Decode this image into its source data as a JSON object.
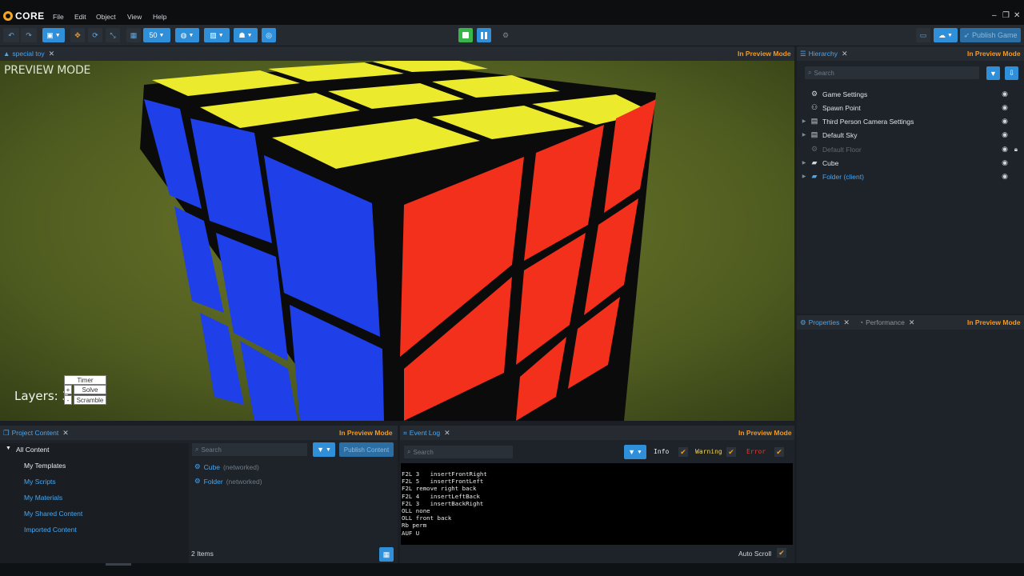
{
  "app": {
    "logo_text": "CORE"
  },
  "menu": [
    "File",
    "Edit",
    "Object",
    "View",
    "Help"
  ],
  "window_controls": [
    "–",
    "❐",
    "✕"
  ],
  "toolbar": {
    "grid_size": "50",
    "publish_label": "Publish Game"
  },
  "viewport": {
    "tab_label": "special toy",
    "mode_label": "In Preview Mode",
    "preview_label": "PREVIEW MODE",
    "layers_label": "Layers: 3",
    "layers_minus": "-",
    "buttons": {
      "timer": "Timer",
      "solve": "Solve",
      "scramble": "Scramble"
    }
  },
  "hierarchy": {
    "tab_label": "Hierarchy",
    "mode_label": "In Preview Mode",
    "search_placeholder": "Search",
    "items": [
      {
        "label": "Game Settings"
      },
      {
        "label": "Spawn Point"
      },
      {
        "label": "Third Person Camera Settings"
      },
      {
        "label": "Default Sky"
      },
      {
        "label": "Default Floor"
      },
      {
        "label": "Cube"
      },
      {
        "label": "Folder (client)"
      }
    ]
  },
  "properties": {
    "tab_label": "Properties",
    "performance_tab_label": "Performance",
    "mode_label": "In Preview Mode"
  },
  "project_content": {
    "tab_label": "Project Content",
    "mode_label": "In Preview Mode",
    "tree_root": "All Content",
    "tree_items": [
      "My Templates",
      "My Scripts",
      "My Materials",
      "My Shared Content",
      "Imported Content"
    ],
    "search_placeholder": "Search",
    "publish_label": "Publish Content",
    "items": [
      {
        "name": "Cube",
        "tag": "(networked)"
      },
      {
        "name": "Folder",
        "tag": "(networked)"
      }
    ],
    "count_label": "2 Items"
  },
  "event_log": {
    "tab_label": "Event Log",
    "mode_label": "In Preview Mode",
    "search_placeholder": "Search",
    "filters": {
      "info": "Info",
      "warning": "Warning",
      "error": "Error"
    },
    "lines": "F2L 3   insertFrontRight\nF2L 5   insertFrontLeft\nF2L remove right back\nF2L 4   insertLeftBack\nF2L 3   insertBackRight\nOLL none\nOLL front back\nRb perm\nAUF U",
    "auto_scroll_label": "Auto Scroll"
  },
  "colors": {
    "accent": "#2f8fd8",
    "warning_orange": "#f39a1e",
    "link_blue": "#49a6f0",
    "cube_yellow": "#ecea2c",
    "cube_blue": "#1f3fe8",
    "cube_red": "#f2301c"
  }
}
